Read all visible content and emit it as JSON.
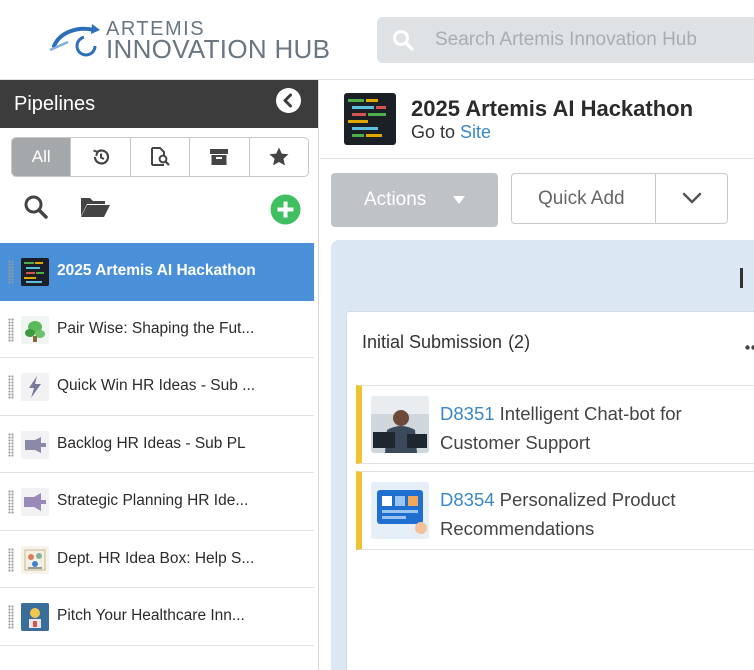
{
  "header": {
    "logo_line1": "ARTEMIS",
    "logo_line2": "INNOVATION HUB",
    "search_placeholder": "Search Artemis Innovation Hub"
  },
  "sidebar": {
    "title": "Pipelines",
    "tabs": [
      {
        "label": "All",
        "icon": null
      },
      {
        "label": "",
        "icon": "history-icon"
      },
      {
        "label": "",
        "icon": "document-search-icon"
      },
      {
        "label": "",
        "icon": "archive-icon"
      },
      {
        "label": "",
        "icon": "star-icon"
      }
    ],
    "pipelines": [
      {
        "label": "2025 Artemis AI Hackathon",
        "active": true
      },
      {
        "label": "Pair Wise: Shaping the Fut..."
      },
      {
        "label": "Quick Win HR Ideas - Sub ..."
      },
      {
        "label": "Backlog HR Ideas - Sub PL"
      },
      {
        "label": "Strategic Planning HR Ide..."
      },
      {
        "label": "Dept. HR Idea Box: Help S..."
      },
      {
        "label": "Pitch Your Healthcare Inn..."
      }
    ]
  },
  "main": {
    "title": "2025 Artemis AI Hackathon",
    "goto_prefix": "Go to",
    "goto_link": "Site",
    "actions_label": "Actions",
    "quick_add_label": "Quick Add",
    "stage": {
      "name": "Initial Submission",
      "count": "(2)",
      "cards": [
        {
          "id": "D8351",
          "title": "Intelligent Chat-bot for Customer Support"
        },
        {
          "id": "D8354",
          "title": "Personalized Product Recommendations"
        }
      ]
    }
  },
  "colors": {
    "accent_blue": "#4a90d9",
    "link_blue": "#3a87c8",
    "header_dark": "#3c3c3c",
    "add_green": "#3fbf5f",
    "card_stripe": "#f0c330",
    "board_bg": "#dbe7f3"
  }
}
